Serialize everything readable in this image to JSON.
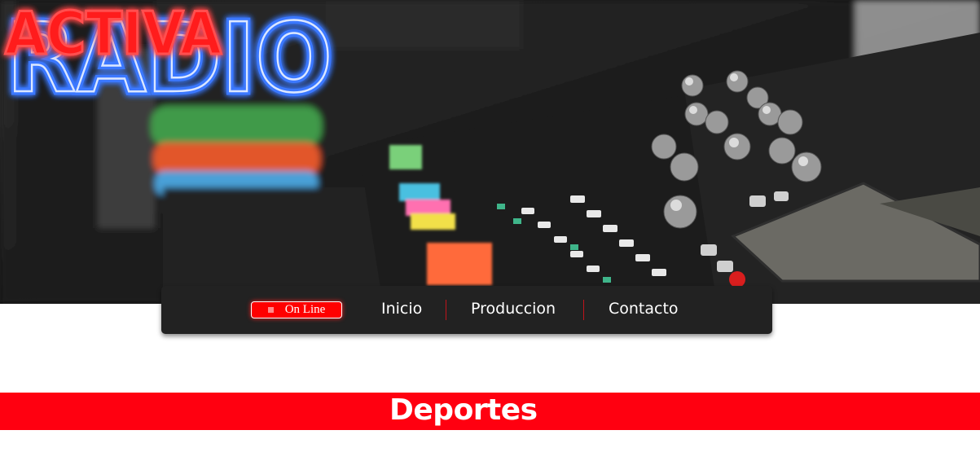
{
  "hero": {
    "logo_line1": "RADIO",
    "logo_line2": "ACTIVA",
    "logo_line1_color": "#3b78ff",
    "logo_line2_color": "#ff1a1a"
  },
  "nav": {
    "online_label": "On Line",
    "links": [
      "Inicio",
      "Produccion",
      "Contacto"
    ],
    "background": "#222222",
    "separator_color": "#c0141b"
  },
  "section": {
    "title": "Deportes",
    "background": "#ff0010"
  }
}
